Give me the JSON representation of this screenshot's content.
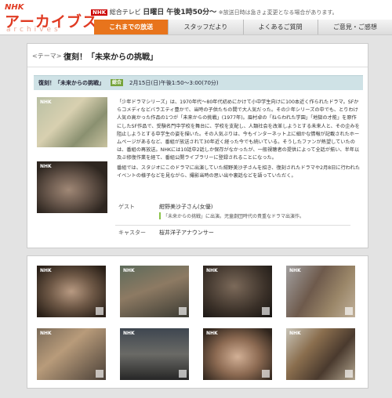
{
  "header": {
    "logo_nhk": "NHK",
    "logo_main": "アーカイブス",
    "logo_sub": "archives",
    "broadcast_badge": "NHK",
    "broadcast_channel": "総合テレビ",
    "broadcast_time": "日曜日 午後1時50分〜",
    "broadcast_note": "※放送日時は急きょ変更となる場合があります。",
    "accent_color": "#e8741c",
    "brand_color": "#e03a22"
  },
  "nav": {
    "tabs": [
      {
        "label": "これまでの放送",
        "active": true
      },
      {
        "label": "スタッフだより",
        "active": false
      },
      {
        "label": "よくあるご質問",
        "active": false
      },
      {
        "label": "ご意見・ご感想",
        "active": false
      }
    ]
  },
  "theme": {
    "label": "<テーマ>",
    "title": "復刻！「未来からの挑戦」"
  },
  "program": {
    "title": "復刻！「未来からの挑戦」",
    "channel_badge": "総合",
    "air_time": "2月15日(日)午後1:50〜3:00(70分)",
    "image_tag": "NHK",
    "description": [
      "「少年ドラマシリーズ」は、1970年代〜80年代初めにかけて小中学生向けに100本近く作られたドラマ。SFからコメディなどバラエティ豊かで、当時の子供たちの間で大人気だった。その少年シリーズの中でも、とりわけ人気の高かった作品の1つが「未来からの挑戦」(1977年)。眉村卓の「ねらわれた学園」「地獄の才能」を原作にしたSF作品で、受験名門中学校を舞台に、学校を支配し、人類社会を改革しようとする未来人と、その企みを阻止しようとする中学生の姿を描いた。その人気ぶりは、今もインターネット上に細かな情報が記載されたホームページがあるなど、番組が放送されて30年近く経った今でも続いている。そうしたファンが熱望していたのは、番組の再放送。NHKには10話中2話しか保存がなかったが、一般視聴者の提供によって全話が揃い、半年以及ぶ修復作業を経て、番組公開ライブラリーに登録されることになった。",
      "番組では、スタジオにこのドラマに出演していた紺野美沙子さんを招き、復刻されたドラマや2月8日に行われたイベントの様子などを見ながら、撮影当時の思い出や裏話などを語っていただく。"
    ],
    "guest_label": "ゲスト",
    "guest_value": "紺野美沙子さん(女優)",
    "guest_note": "「未来からの挑戦」に出演。児童劇団時代の貴重なドラマ出演作。",
    "caster_label": "キャスター",
    "caster_value": "桜井洋子アナウンサー"
  },
  "gallery": {
    "thumbnails": [
      {
        "tag": "NHK",
        "icon": "play-icon"
      },
      {
        "tag": "NHK",
        "icon": "play-icon"
      },
      {
        "tag": "NHK",
        "icon": "play-icon"
      },
      {
        "tag": "NHK",
        "icon": "play-icon"
      },
      {
        "tag": "NHK",
        "icon": "play-icon"
      },
      {
        "tag": "NHK",
        "icon": "play-icon"
      },
      {
        "tag": "NHK",
        "icon": "play-icon"
      },
      {
        "tag": "NHK",
        "icon": "play-icon"
      }
    ]
  }
}
